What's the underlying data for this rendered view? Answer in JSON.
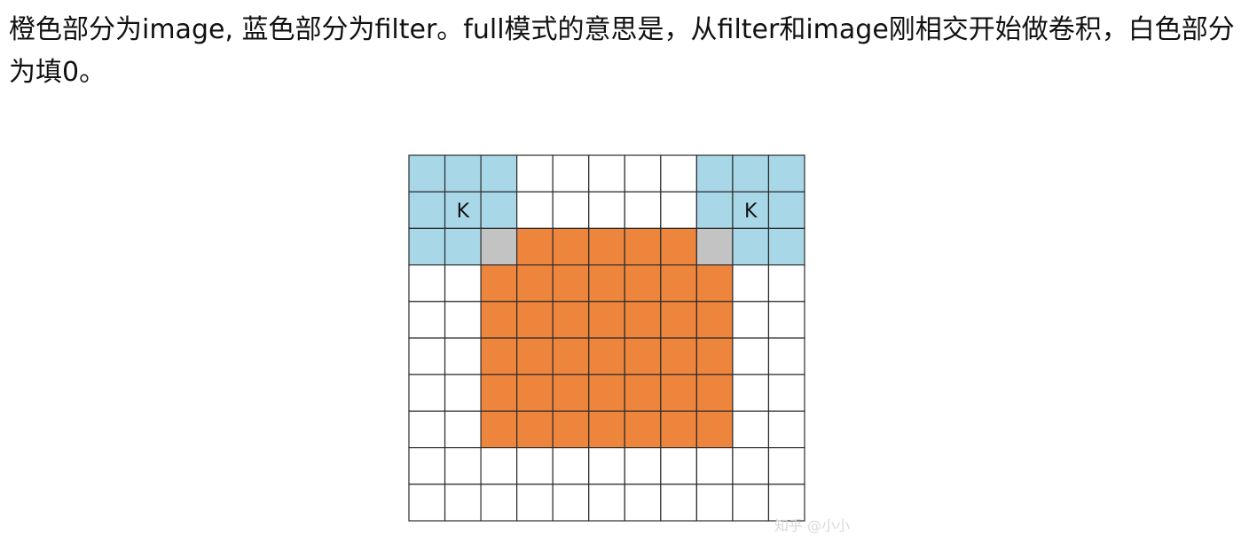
{
  "article": {
    "paragraph": "橙色部分为image, 蓝色部分为filter。full模式的意思是，从filter和image刚相交开始做卷积，白色部分为填0。"
  },
  "figure": {
    "rows": 10,
    "cols": 11,
    "colors": {
      "white": "#ffffff",
      "blue": "#a8d8e8",
      "orange": "#ee853d",
      "gray": "#c3c3c3",
      "line": "#2b2b2b"
    },
    "cell_types": [
      [
        "blue",
        "blue",
        "blue",
        "white",
        "white",
        "white",
        "white",
        "white",
        "blue",
        "blue",
        "blue"
      ],
      [
        "blue",
        "blue",
        "blue",
        "white",
        "white",
        "white",
        "white",
        "white",
        "blue",
        "blue",
        "blue"
      ],
      [
        "blue",
        "blue",
        "gray",
        "orange",
        "orange",
        "orange",
        "orange",
        "orange",
        "gray",
        "blue",
        "blue"
      ],
      [
        "white",
        "white",
        "orange",
        "orange",
        "orange",
        "orange",
        "orange",
        "orange",
        "orange",
        "white",
        "white"
      ],
      [
        "white",
        "white",
        "orange",
        "orange",
        "orange",
        "orange",
        "orange",
        "orange",
        "orange",
        "white",
        "white"
      ],
      [
        "white",
        "white",
        "orange",
        "orange",
        "orange",
        "orange",
        "orange",
        "orange",
        "orange",
        "white",
        "white"
      ],
      [
        "white",
        "white",
        "orange",
        "orange",
        "orange",
        "orange",
        "orange",
        "orange",
        "orange",
        "white",
        "white"
      ],
      [
        "white",
        "white",
        "orange",
        "orange",
        "orange",
        "orange",
        "orange",
        "orange",
        "orange",
        "white",
        "white"
      ],
      [
        "white",
        "white",
        "white",
        "white",
        "white",
        "white",
        "white",
        "white",
        "white",
        "white",
        "white"
      ],
      [
        "white",
        "white",
        "white",
        "white",
        "white",
        "white",
        "white",
        "white",
        "white",
        "white",
        "white"
      ]
    ],
    "kernel_labels": [
      {
        "text": "K",
        "row": 1,
        "col": 1
      },
      {
        "text": "K",
        "row": 1,
        "col": 9
      }
    ]
  },
  "watermark": {
    "text": "知乎 @小小"
  }
}
